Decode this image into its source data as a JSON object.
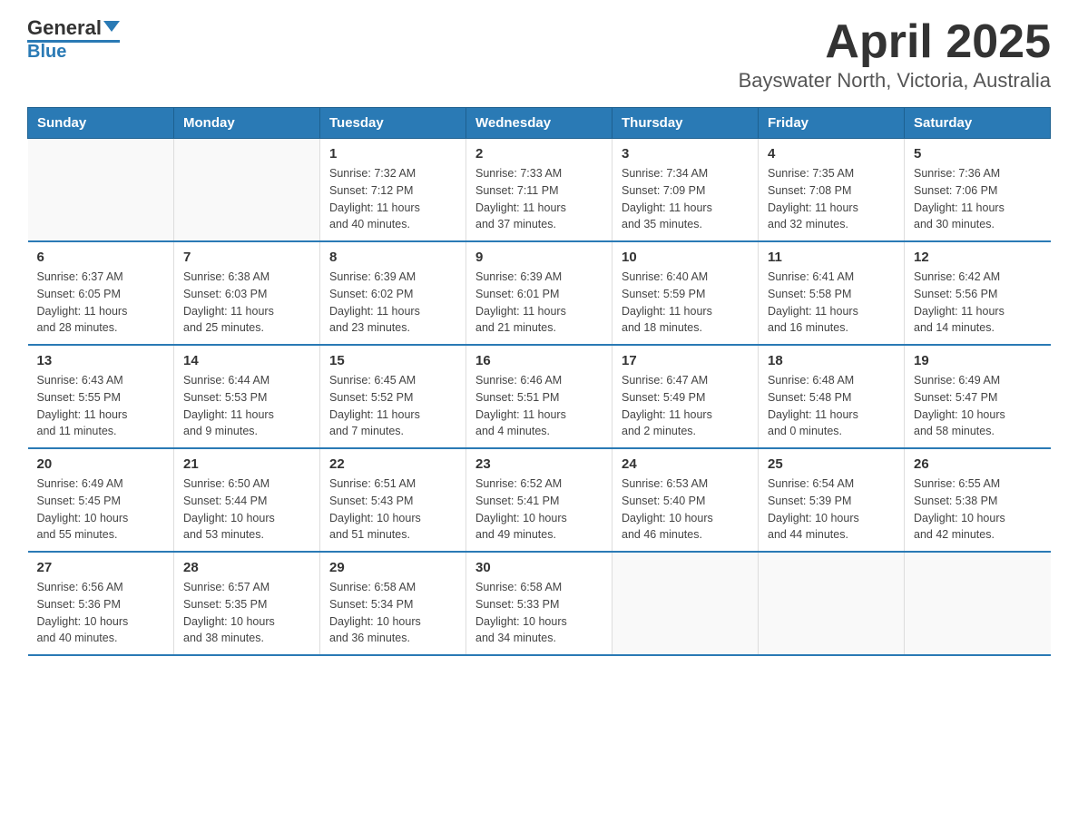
{
  "header": {
    "logo": {
      "text1": "General",
      "text2": "Blue"
    },
    "title": "April 2025",
    "subtitle": "Bayswater North, Victoria, Australia"
  },
  "calendar": {
    "days_of_week": [
      "Sunday",
      "Monday",
      "Tuesday",
      "Wednesday",
      "Thursday",
      "Friday",
      "Saturday"
    ],
    "weeks": [
      [
        {
          "day": "",
          "info": ""
        },
        {
          "day": "",
          "info": ""
        },
        {
          "day": "1",
          "info": "Sunrise: 7:32 AM\nSunset: 7:12 PM\nDaylight: 11 hours\nand 40 minutes."
        },
        {
          "day": "2",
          "info": "Sunrise: 7:33 AM\nSunset: 7:11 PM\nDaylight: 11 hours\nand 37 minutes."
        },
        {
          "day": "3",
          "info": "Sunrise: 7:34 AM\nSunset: 7:09 PM\nDaylight: 11 hours\nand 35 minutes."
        },
        {
          "day": "4",
          "info": "Sunrise: 7:35 AM\nSunset: 7:08 PM\nDaylight: 11 hours\nand 32 minutes."
        },
        {
          "day": "5",
          "info": "Sunrise: 7:36 AM\nSunset: 7:06 PM\nDaylight: 11 hours\nand 30 minutes."
        }
      ],
      [
        {
          "day": "6",
          "info": "Sunrise: 6:37 AM\nSunset: 6:05 PM\nDaylight: 11 hours\nand 28 minutes."
        },
        {
          "day": "7",
          "info": "Sunrise: 6:38 AM\nSunset: 6:03 PM\nDaylight: 11 hours\nand 25 minutes."
        },
        {
          "day": "8",
          "info": "Sunrise: 6:39 AM\nSunset: 6:02 PM\nDaylight: 11 hours\nand 23 minutes."
        },
        {
          "day": "9",
          "info": "Sunrise: 6:39 AM\nSunset: 6:01 PM\nDaylight: 11 hours\nand 21 minutes."
        },
        {
          "day": "10",
          "info": "Sunrise: 6:40 AM\nSunset: 5:59 PM\nDaylight: 11 hours\nand 18 minutes."
        },
        {
          "day": "11",
          "info": "Sunrise: 6:41 AM\nSunset: 5:58 PM\nDaylight: 11 hours\nand 16 minutes."
        },
        {
          "day": "12",
          "info": "Sunrise: 6:42 AM\nSunset: 5:56 PM\nDaylight: 11 hours\nand 14 minutes."
        }
      ],
      [
        {
          "day": "13",
          "info": "Sunrise: 6:43 AM\nSunset: 5:55 PM\nDaylight: 11 hours\nand 11 minutes."
        },
        {
          "day": "14",
          "info": "Sunrise: 6:44 AM\nSunset: 5:53 PM\nDaylight: 11 hours\nand 9 minutes."
        },
        {
          "day": "15",
          "info": "Sunrise: 6:45 AM\nSunset: 5:52 PM\nDaylight: 11 hours\nand 7 minutes."
        },
        {
          "day": "16",
          "info": "Sunrise: 6:46 AM\nSunset: 5:51 PM\nDaylight: 11 hours\nand 4 minutes."
        },
        {
          "day": "17",
          "info": "Sunrise: 6:47 AM\nSunset: 5:49 PM\nDaylight: 11 hours\nand 2 minutes."
        },
        {
          "day": "18",
          "info": "Sunrise: 6:48 AM\nSunset: 5:48 PM\nDaylight: 11 hours\nand 0 minutes."
        },
        {
          "day": "19",
          "info": "Sunrise: 6:49 AM\nSunset: 5:47 PM\nDaylight: 10 hours\nand 58 minutes."
        }
      ],
      [
        {
          "day": "20",
          "info": "Sunrise: 6:49 AM\nSunset: 5:45 PM\nDaylight: 10 hours\nand 55 minutes."
        },
        {
          "day": "21",
          "info": "Sunrise: 6:50 AM\nSunset: 5:44 PM\nDaylight: 10 hours\nand 53 minutes."
        },
        {
          "day": "22",
          "info": "Sunrise: 6:51 AM\nSunset: 5:43 PM\nDaylight: 10 hours\nand 51 minutes."
        },
        {
          "day": "23",
          "info": "Sunrise: 6:52 AM\nSunset: 5:41 PM\nDaylight: 10 hours\nand 49 minutes."
        },
        {
          "day": "24",
          "info": "Sunrise: 6:53 AM\nSunset: 5:40 PM\nDaylight: 10 hours\nand 46 minutes."
        },
        {
          "day": "25",
          "info": "Sunrise: 6:54 AM\nSunset: 5:39 PM\nDaylight: 10 hours\nand 44 minutes."
        },
        {
          "day": "26",
          "info": "Sunrise: 6:55 AM\nSunset: 5:38 PM\nDaylight: 10 hours\nand 42 minutes."
        }
      ],
      [
        {
          "day": "27",
          "info": "Sunrise: 6:56 AM\nSunset: 5:36 PM\nDaylight: 10 hours\nand 40 minutes."
        },
        {
          "day": "28",
          "info": "Sunrise: 6:57 AM\nSunset: 5:35 PM\nDaylight: 10 hours\nand 38 minutes."
        },
        {
          "day": "29",
          "info": "Sunrise: 6:58 AM\nSunset: 5:34 PM\nDaylight: 10 hours\nand 36 minutes."
        },
        {
          "day": "30",
          "info": "Sunrise: 6:58 AM\nSunset: 5:33 PM\nDaylight: 10 hours\nand 34 minutes."
        },
        {
          "day": "",
          "info": ""
        },
        {
          "day": "",
          "info": ""
        },
        {
          "day": "",
          "info": ""
        }
      ]
    ]
  }
}
